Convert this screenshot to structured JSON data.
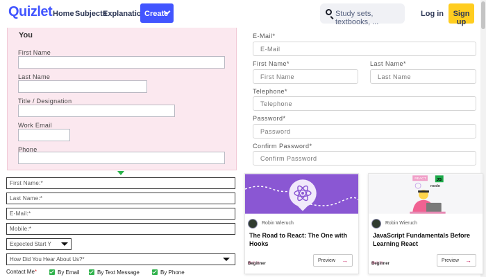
{
  "header": {
    "logo": "Quizlet",
    "nav": [
      "Home",
      "Subjects",
      "Explanations"
    ],
    "create_label": "Create",
    "search_placeholder": "Study sets, textbooks, ...",
    "login_label": "Log in",
    "signup_label": "Sign up"
  },
  "pink_form": {
    "title": "You",
    "fields": [
      "First Name",
      "Last Name",
      "Title / Designation",
      "Work Email",
      "Phone"
    ]
  },
  "right_form": {
    "email_label": "E-Mail*",
    "email_placeholder": "E-Mail",
    "first_name_label": "First Name*",
    "first_name_placeholder": "First Name",
    "last_name_label": "Last Name*",
    "last_name_placeholder": "Last Name",
    "telephone_label": "Telephone*",
    "telephone_placeholder": "Telephone",
    "password_label": "Password*",
    "password_placeholder": "Password",
    "confirm_label": "Confirm Password*",
    "confirm_placeholder": "Confirm Password"
  },
  "left_form": {
    "first_name": "First Name:*",
    "last_name": "Last Name:*",
    "email": "E-Mail:*",
    "mobile": "Mobile:*",
    "start_select": "Expected Start Y",
    "hear_select": "How Did You Hear About Us?*",
    "contact_label": "Contact Me",
    "contact_required": "*",
    "options": [
      "By Email",
      "By Text Message",
      "By Phone"
    ]
  },
  "cards": [
    {
      "author": "Robin Wieruch",
      "title": "The Road to React: The One with Hooks",
      "level": "Beginner",
      "preview": "Preview"
    },
    {
      "author": "Robin Wieruch",
      "title": "JavaScript Fundamentals Before Learning React",
      "level": "Beginner",
      "preview": "Preview",
      "badges": [
        "REACT",
        "JS",
        "node"
      ]
    }
  ],
  "colors": {
    "brand": "#4255ff",
    "signup": "#ffcd1f",
    "pink_bg": "#fbe8ef",
    "checkbox": "#2fb24b",
    "card1_hero": "#8a57d3"
  }
}
